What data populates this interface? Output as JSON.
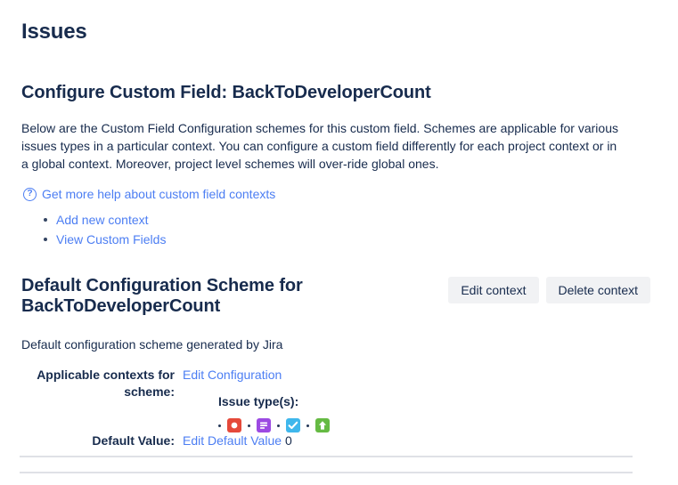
{
  "header": {
    "title": "Issues"
  },
  "config": {
    "heading": "Configure Custom Field: BackToDeveloperCount",
    "description": "Below are the Custom Field Configuration schemes for this custom field. Schemes are applicable for various issues types in a particular context. You can configure a custom field differently for each project context or in a global context. Moreover, project level schemes will over-ride global ones.",
    "help_icon": "question-circle-icon",
    "help_link": "Get more help about custom field contexts",
    "operations": [
      {
        "label": "Add new context"
      },
      {
        "label": "View Custom Fields"
      }
    ]
  },
  "scheme": {
    "title": "Default Configuration Scheme for BackToDeveloperCount",
    "description": "Default configuration scheme generated by Jira",
    "edit_button": "Edit context",
    "delete_button": "Delete context",
    "applicable_label": "Applicable contexts for scheme:",
    "edit_configuration_link": "Edit Configuration",
    "issue_types_label": "Issue type(s):",
    "issue_types": [
      {
        "name": "bug-issue-type-icon",
        "color": "#e5493a",
        "glyph": "bug"
      },
      {
        "name": "story-issue-type-icon",
        "color": "#9c4ae2",
        "glyph": "story"
      },
      {
        "name": "task-issue-type-icon",
        "color": "#3fb7ec",
        "glyph": "task"
      },
      {
        "name": "improvement-issue-type-icon",
        "color": "#65ba43",
        "glyph": "improvement"
      }
    ],
    "default_value_label": "Default Value:",
    "edit_default_value_link": "Edit Default Value",
    "default_value": "0"
  },
  "colors": {
    "link": "#4c7ef3",
    "text": "#172b4d",
    "button_bg": "#f1f2f4",
    "divider": "#dfe1e6"
  }
}
